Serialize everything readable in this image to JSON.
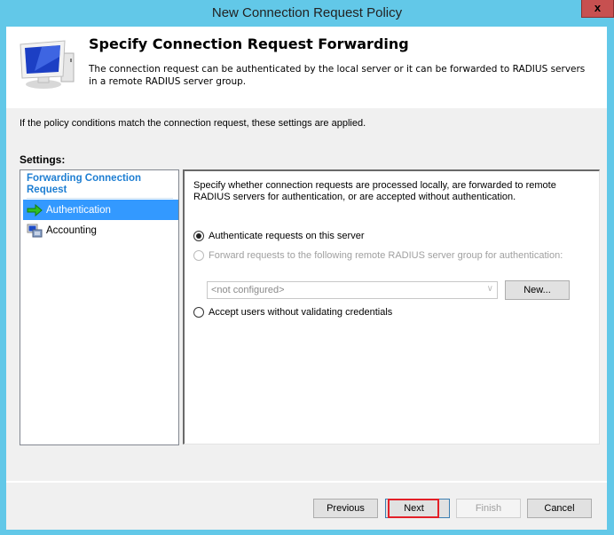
{
  "window": {
    "title": "New Connection Request Policy",
    "close_label": "x"
  },
  "header": {
    "icon": "computer-monitor-icon",
    "title": "Specify Connection Request Forwarding",
    "description": "The connection request can be authenticated by the local server or it can be forwarded to RADIUS servers in a remote RADIUS server group."
  },
  "intro": "If the policy conditions match the connection request, these settings are applied.",
  "settings_label": "Settings:",
  "nav": {
    "group_label": "Forwarding Connection Request",
    "items": [
      {
        "label": "Authentication",
        "icon": "green-arrow-icon",
        "selected": true
      },
      {
        "label": "Accounting",
        "icon": "accounting-server-icon",
        "selected": false
      }
    ]
  },
  "panel": {
    "description": "Specify whether connection requests are processed locally, are forwarded to remote RADIUS servers for authentication, or are accepted without authentication.",
    "options": [
      {
        "label": "Authenticate requests on this server",
        "checked": true,
        "enabled": true
      },
      {
        "label": "Forward requests to the following remote RADIUS server group for authentication:",
        "checked": false,
        "enabled": false
      },
      {
        "label": "Accept users without validating credentials",
        "checked": false,
        "enabled": true
      }
    ],
    "server_group_select": {
      "value": "<not configured>",
      "enabled": false
    },
    "new_button": "New..."
  },
  "footer": {
    "previous": "Previous",
    "next": "Next",
    "finish": "Finish",
    "cancel": "Cancel",
    "highlight_color": "#e32028"
  }
}
